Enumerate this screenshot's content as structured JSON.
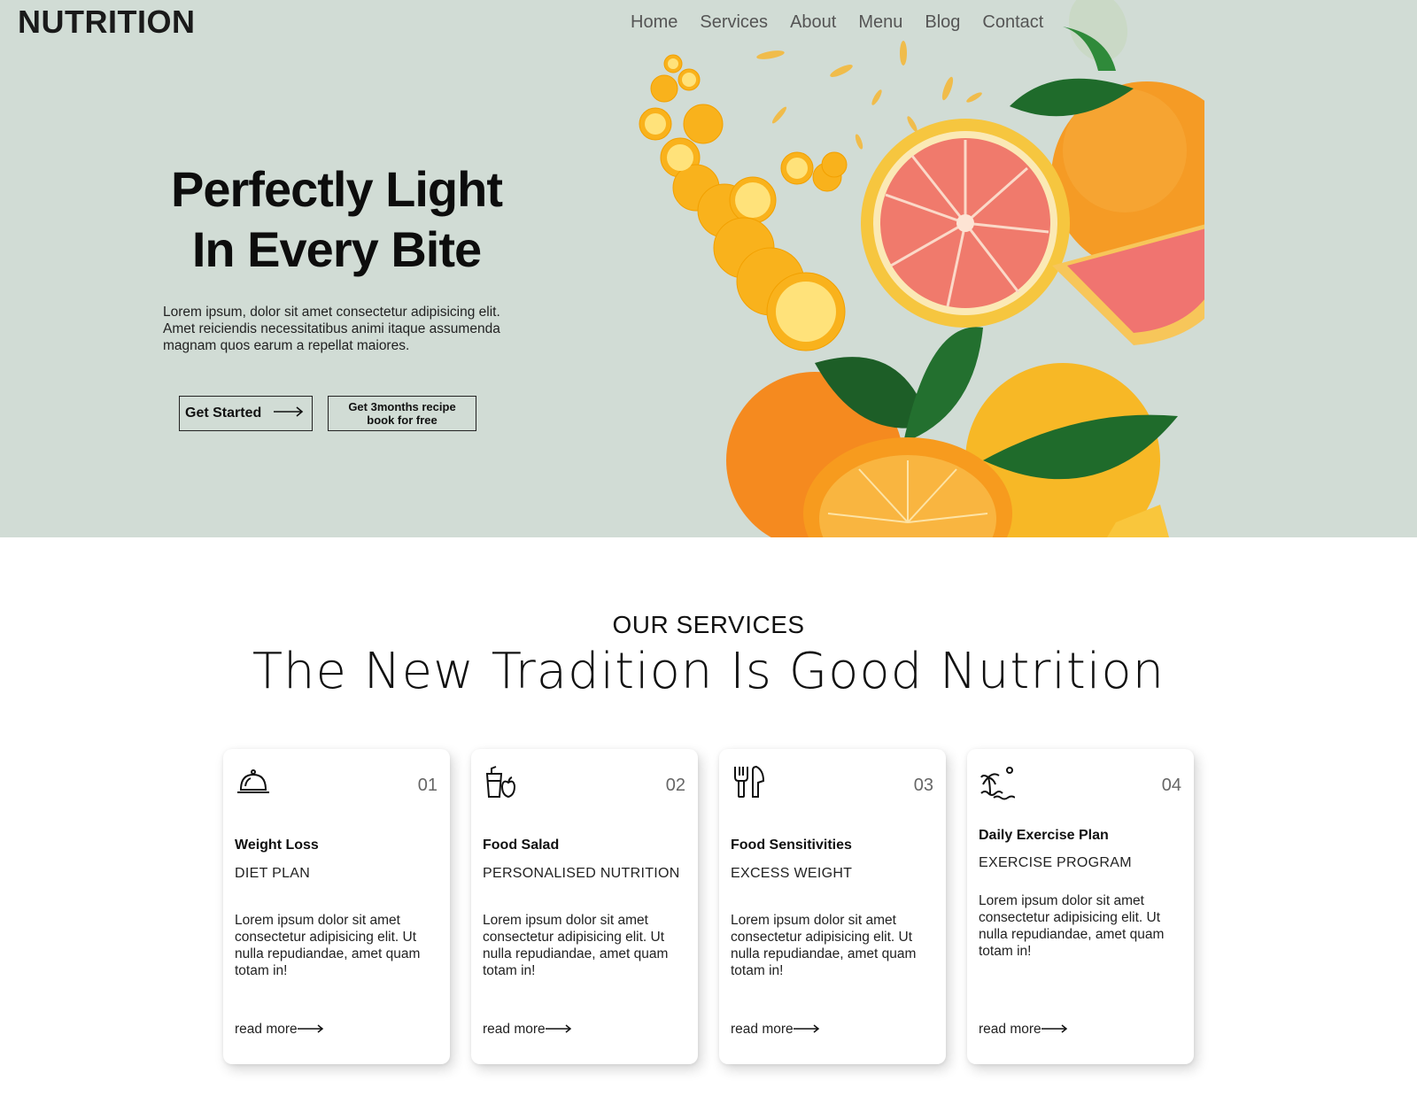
{
  "header": {
    "logo": "NUTRITION",
    "nav": [
      "Home",
      "Services",
      "About",
      "Menu",
      "Blog",
      "Contact"
    ]
  },
  "hero": {
    "title_line1": "Perfectly Light",
    "title_line2": "In Every Bite",
    "description": "Lorem ipsum, dolor sit amet consectetur adipisicing elit. Amet reiciendis necessitatibus animi itaque assumenda magnam quos earum a repellat maiores.",
    "cta_primary": "Get Started",
    "cta_secondary": "Get 3months recipe book for free"
  },
  "services": {
    "eyebrow": "OUR SERVICES",
    "heading": "The New Tradition Is Good Nutrition",
    "cards": [
      {
        "number": "01",
        "icon": "cloche-icon",
        "title": "Weight Loss",
        "subtitle": "DIET PLAN",
        "body": "Lorem ipsum dolor sit amet consectetur adipisicing elit. Ut nulla repudiandae, amet quam totam in!",
        "link": "read more"
      },
      {
        "number": "02",
        "icon": "drink-apple-icon",
        "title": "Food Salad",
        "subtitle": "PERSONALISED NUTRITION",
        "body": "Lorem ipsum dolor sit amet consectetur adipisicing elit. Ut nulla repudiandae, amet quam totam in!",
        "link": "read more"
      },
      {
        "number": "03",
        "icon": "fork-knife-icon",
        "title": "Food Sensitivities",
        "subtitle": "EXCESS WEIGHT",
        "body": "Lorem ipsum dolor sit amet consectetur adipisicing elit. Ut nulla repudiandae, amet quam totam in!",
        "link": "read more"
      },
      {
        "number": "04",
        "icon": "island-icon",
        "title": "Daily Exercise Plan",
        "subtitle": "EXERCISE PROGRAM",
        "body": "Lorem ipsum dolor sit amet consectetur adipisicing elit. Ut nulla repudiandae, amet quam totam in!",
        "link": "read more"
      }
    ]
  },
  "colors": {
    "hero_bg": "#d1dcd5",
    "text": "#111111",
    "orange": "#f7931e",
    "grapefruit": "#f26b6b",
    "leaf": "#2e7d32"
  }
}
